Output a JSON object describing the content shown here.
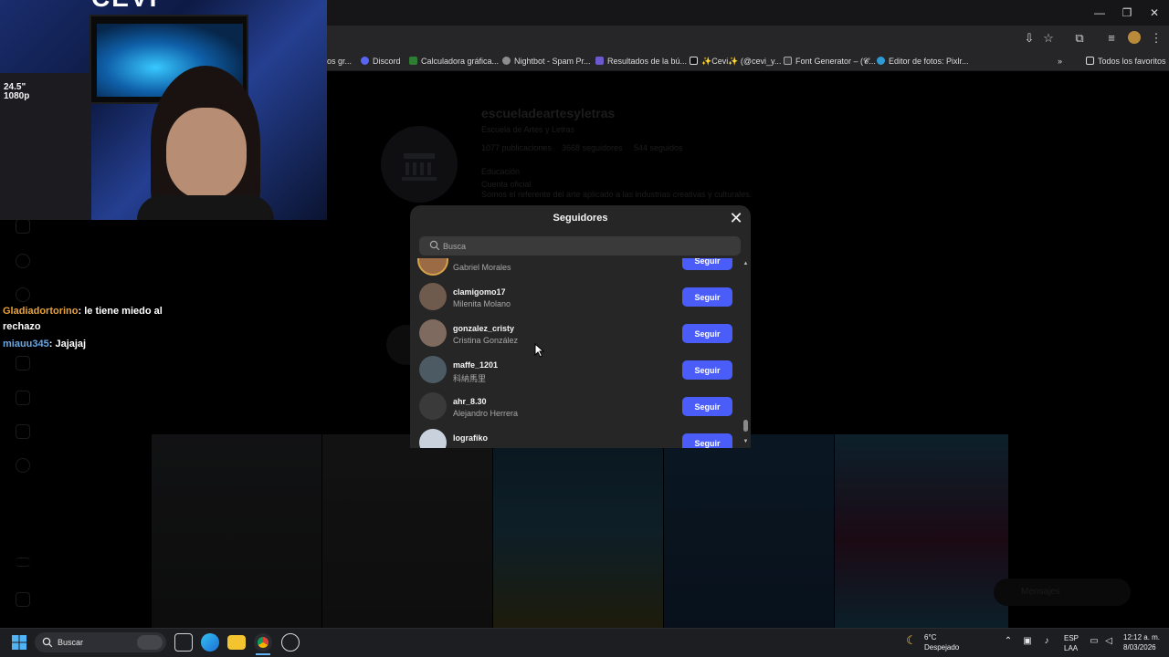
{
  "browser": {
    "window_controls": [
      "—",
      "❐",
      "✕"
    ],
    "bookmarks": [
      {
        "label": "os gr...",
        "icon": "bookmark-icon",
        "color": "#888888"
      },
      {
        "label": "Discord",
        "icon": "discord-icon",
        "color": "#5865f2"
      },
      {
        "label": "Calculadora gráfica...",
        "icon": "desmos-icon",
        "color": "#2f7d32"
      },
      {
        "label": "Nightbot - Spam Pr...",
        "icon": "nightbot-icon",
        "color": "#999999"
      },
      {
        "label": "Resultados de la bú...",
        "icon": "search-results-icon",
        "color": "#6a5acd"
      },
      {
        "label": "✨Cevi✨ (@cevi_y...",
        "icon": "tiktok-icon",
        "color": "#111111"
      },
      {
        "label": "Font Generator – (𝓒...",
        "icon": "font-icon",
        "color": "#3a3a3a"
      },
      {
        "label": "Editor de fotos: Pixlr...",
        "icon": "pixlr-icon",
        "color": "#2f9bd6"
      }
    ],
    "all_favorites": "Todos los favoritos"
  },
  "background_profile": {
    "username": "escueladeartesyletras",
    "fullname": "Escuela de Artes y Letras",
    "stats": [
      "1077 publicaciones",
      "3668 seguidores",
      "544 seguidos"
    ],
    "category": "Educación",
    "bio_line1": "Cuenta oficial",
    "bio_line2": "Somos el referente del arte aplicado a las industrias creativas y culturales.",
    "messages": "Mensajes"
  },
  "webcam": {
    "label_line1": "24.5\"",
    "label_line2": "1080p",
    "big_text": "CEVI"
  },
  "chat": [
    {
      "user": "Gladiadortorino",
      "message": ": le tiene miedo al rechazo"
    },
    {
      "user": "miauu345",
      "message": ": Jajajaj"
    }
  ],
  "modal": {
    "title": "Seguidores",
    "search_placeholder": "Busca",
    "follow_label": "Seguir",
    "followers": [
      {
        "username": "",
        "fullname": "Gabriel Morales",
        "avatar_color": "#9a6b45",
        "avatar_ring": "#d6a34a"
      },
      {
        "username": "clamigomo17",
        "fullname": "Milenita Molano",
        "avatar_color": "#6f5a4e"
      },
      {
        "username": "gonzalez_cristy",
        "fullname": "Cristina González",
        "avatar_color": "#7e6a5e"
      },
      {
        "username": "maffe_1201",
        "fullname": "科納馬里",
        "avatar_color": "#4b5a63"
      },
      {
        "username": "ahr_8.30",
        "fullname": "Alejandro Herrera",
        "avatar_color": "#3a3a3a"
      },
      {
        "username": "lografiko",
        "fullname": "",
        "avatar_color": "#c9d2dc"
      }
    ]
  },
  "taskbar": {
    "search_label": "Buscar",
    "weather_temp": "6°C",
    "weather_desc": "Despejado",
    "lang_line1": "ESP",
    "lang_line2": "LAA",
    "time": "12:12 a. m.",
    "date": "8/03/2026"
  },
  "colors": {
    "follow_button": "#4a5df9",
    "modal_bg": "#262626",
    "taskbar_bg": "#1d1e22"
  }
}
